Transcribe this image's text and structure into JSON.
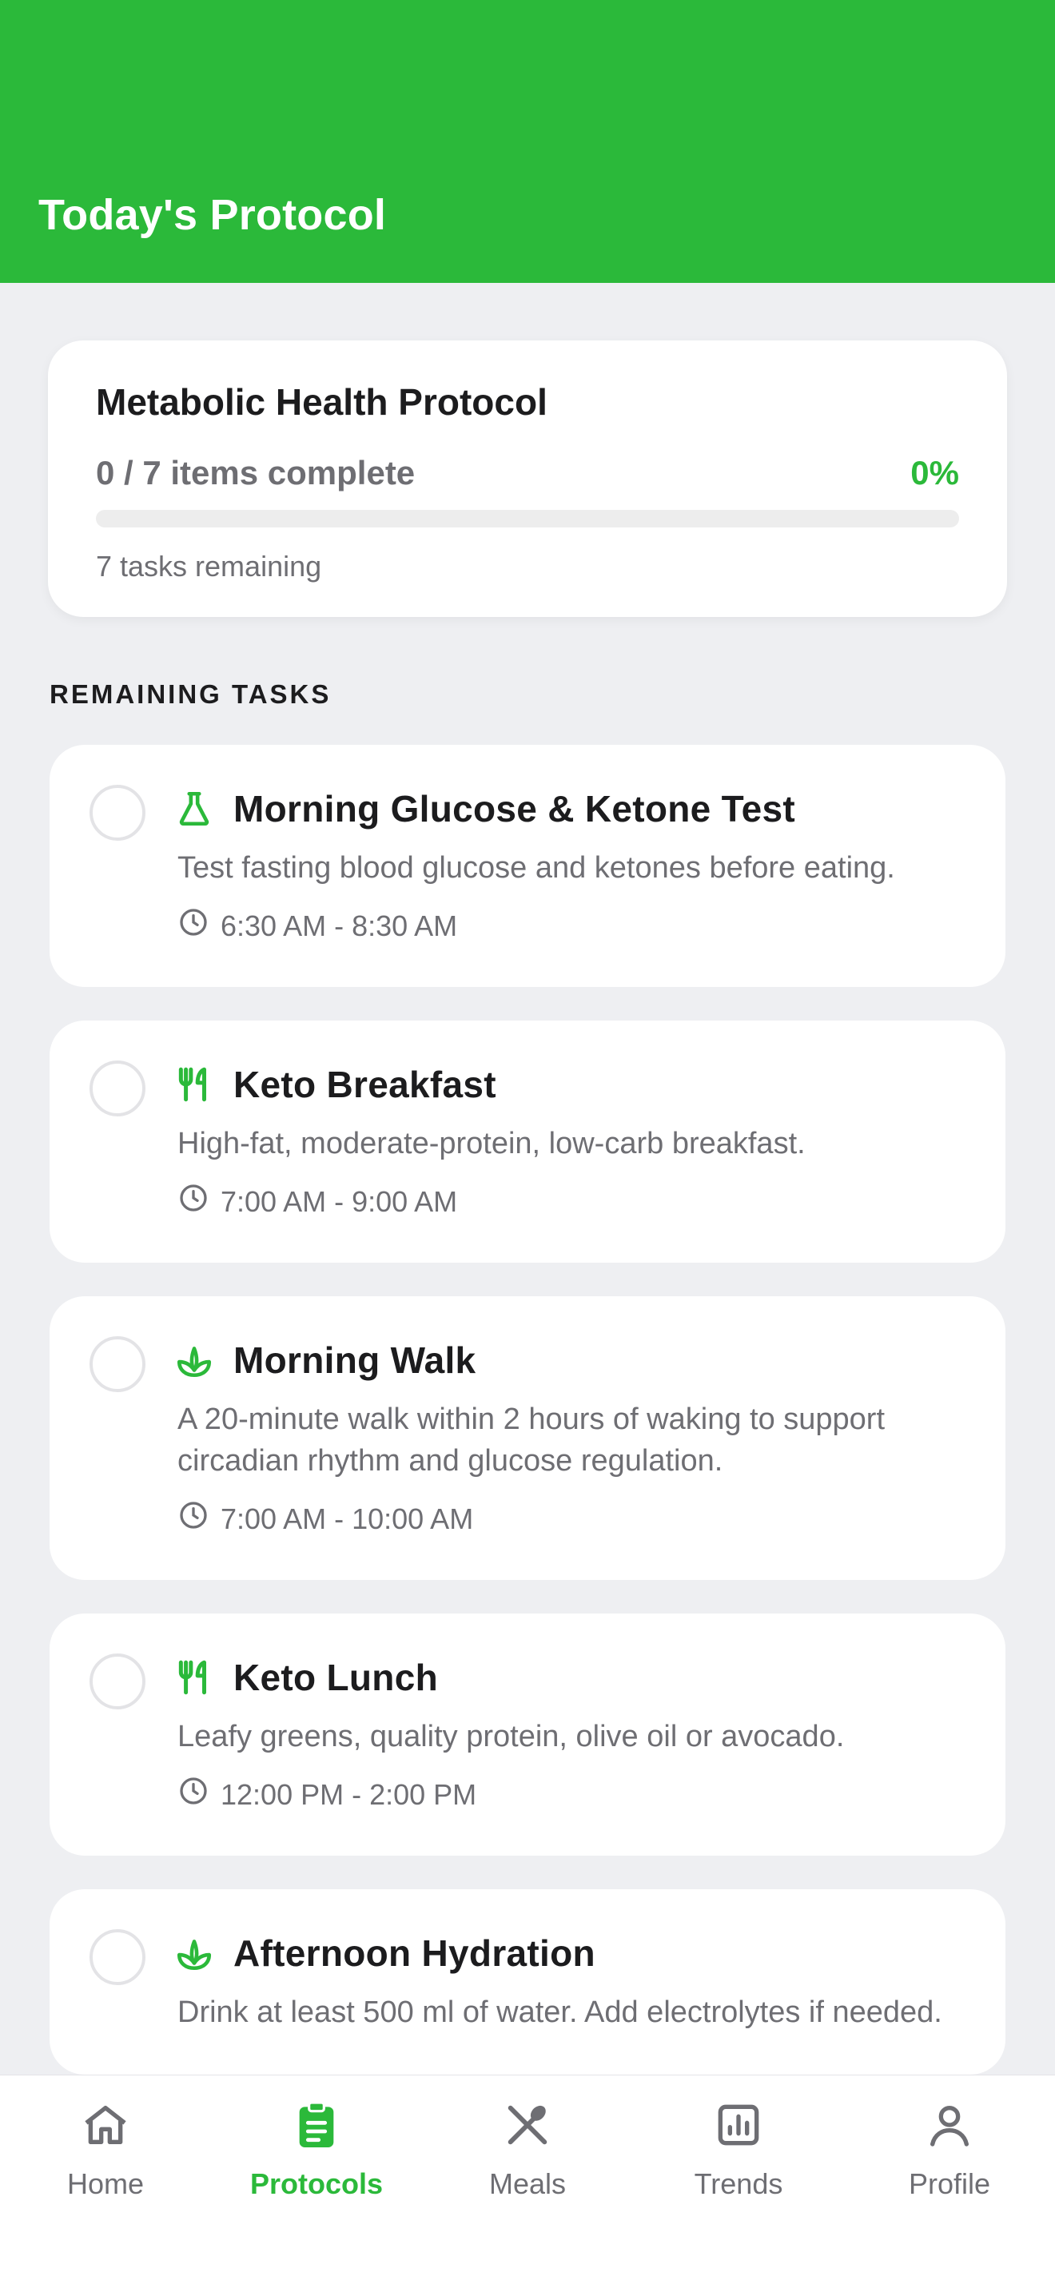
{
  "header": {
    "title": "Today's Protocol"
  },
  "summary": {
    "title": "Metabolic Health Protocol",
    "count_text": "0 / 7 items complete",
    "percent_text": "0%",
    "progress_fraction": 0,
    "remaining_text": "7 tasks remaining"
  },
  "section": {
    "label": "REMAINING TASKS"
  },
  "tasks": [
    {
      "icon": "flask-icon",
      "title": "Morning Glucose & Ketone Test",
      "description": "Test fasting blood glucose and ketones before eating.",
      "time": "6:30 AM - 8:30 AM"
    },
    {
      "icon": "utensils-icon",
      "title": "Keto Breakfast",
      "description": "High-fat, moderate-protein, low-carb breakfast.",
      "time": "7:00 AM - 9:00 AM"
    },
    {
      "icon": "sprout-icon",
      "title": "Morning Walk",
      "description": "A 20-minute walk within 2 hours of waking to support circadian rhythm and glucose regulation.",
      "time": "7:00 AM - 10:00 AM"
    },
    {
      "icon": "utensils-icon",
      "title": "Keto Lunch",
      "description": "Leafy greens, quality protein, olive oil or avocado.",
      "time": "12:00 PM - 2:00 PM"
    },
    {
      "icon": "sprout-icon",
      "title": "Afternoon Hydration",
      "description": "Drink at least 500 ml of water. Add electrolytes if needed.",
      "time": ""
    }
  ],
  "tabs": [
    {
      "label": "Home",
      "icon": "home-icon",
      "active": false
    },
    {
      "label": "Protocols",
      "icon": "clipboard-icon",
      "active": true
    },
    {
      "label": "Meals",
      "icon": "fork-spoon-icon",
      "active": false
    },
    {
      "label": "Trends",
      "icon": "chart-icon",
      "active": false
    },
    {
      "label": "Profile",
      "icon": "person-icon",
      "active": false
    }
  ],
  "colors": {
    "accent": "#2BB93A",
    "background": "#EEEFF2",
    "muted_text": "#6E6E73"
  }
}
